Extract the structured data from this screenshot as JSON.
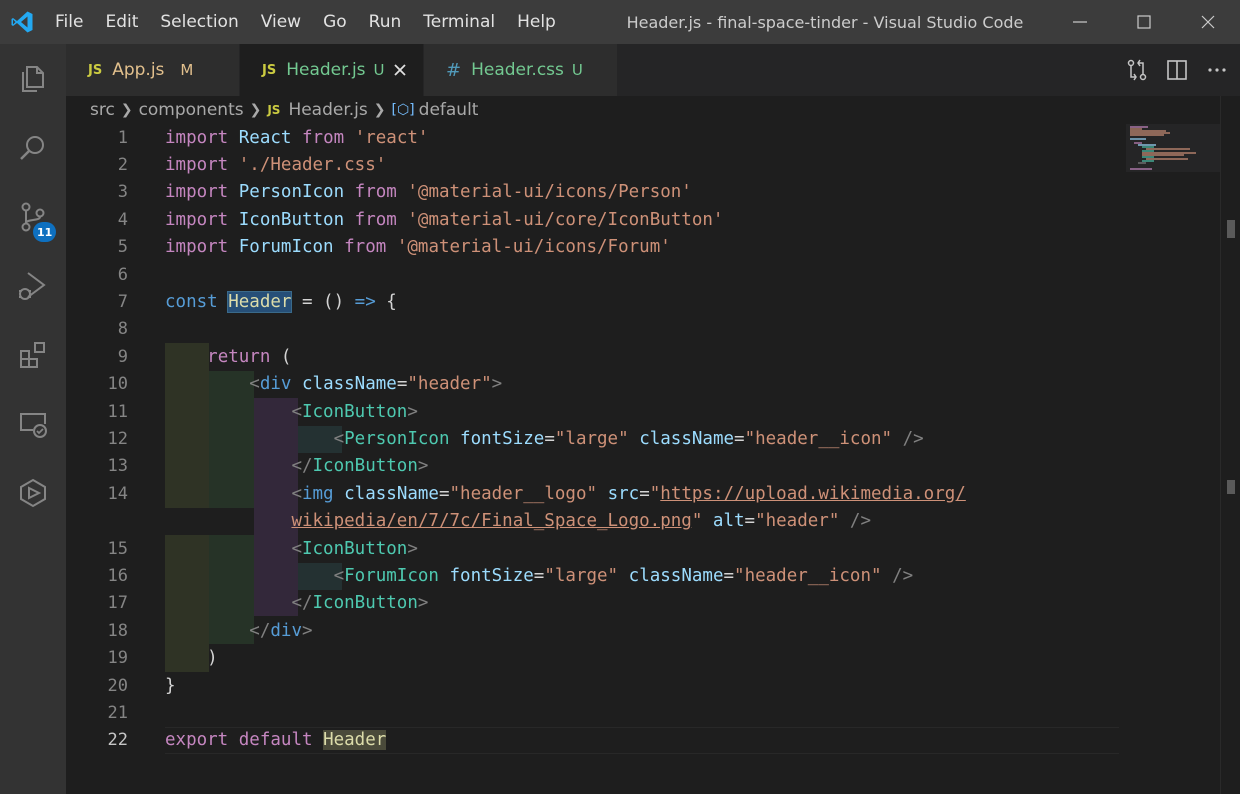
{
  "window": {
    "title": "Header.js - final-space-tinder - Visual Studio Code",
    "menu": [
      "File",
      "Edit",
      "Selection",
      "View",
      "Go",
      "Run",
      "Terminal",
      "Help"
    ]
  },
  "activity_bar": {
    "items": [
      "explorer-icon",
      "search-icon",
      "source-control-icon",
      "run-debug-icon",
      "extensions-icon",
      "remote-explorer-icon",
      "live-share-icon"
    ],
    "source_control_badge": "11"
  },
  "tabs": [
    {
      "icon": "JS",
      "label": "App.js",
      "status": "M",
      "active": false
    },
    {
      "icon": "JS",
      "label": "Header.js",
      "status": "U",
      "active": true
    },
    {
      "icon": "#",
      "label": "Header.css",
      "status": "U",
      "active": false
    }
  ],
  "breadcrumb": {
    "parts": [
      "src",
      "components"
    ],
    "file_icon": "JS",
    "file": "Header.js",
    "symbol": "default"
  },
  "editor": {
    "current_line": 22,
    "line_numbers": [
      "1",
      "2",
      "3",
      "4",
      "5",
      "6",
      "7",
      "8",
      "9",
      "10",
      "11",
      "12",
      "13",
      "14",
      "",
      "15",
      "16",
      "17",
      "18",
      "19",
      "20",
      "21",
      "22"
    ],
    "code_lines": [
      "import React from 'react'",
      "import './Header.css'",
      "import PersonIcon from '@material-ui/icons/Person'",
      "import IconButton from '@material-ui/core/IconButton'",
      "import ForumIcon from '@material-ui/icons/Forum'",
      "",
      "const Header = () => {",
      "",
      "    return (",
      "        <div className=\"header\">",
      "            <IconButton>",
      "                <PersonIcon fontSize=\"large\" className=\"header__icon\" />",
      "            </IconButton>",
      "            <img className=\"header__logo\" src=\"https://upload.wikimedia.org/",
      "            wikipedia/en/7/7c/Final_Space_Logo.png\" alt=\"header\" />",
      "            <IconButton>",
      "                <ForumIcon fontSize=\"large\" className=\"header__icon\" />",
      "            </IconButton>",
      "        </div>",
      "    )",
      "}",
      "",
      "export default Header"
    ]
  },
  "colors": {
    "title_bar": "#3c3c3c",
    "activity_bar": "#333333",
    "editor_bg": "#1e1e1e",
    "keyword": "#c586c0",
    "string": "#ce9178",
    "variable": "#9cdcfe",
    "component": "#4ec9b0",
    "accent_badge": "#0e70c0"
  }
}
